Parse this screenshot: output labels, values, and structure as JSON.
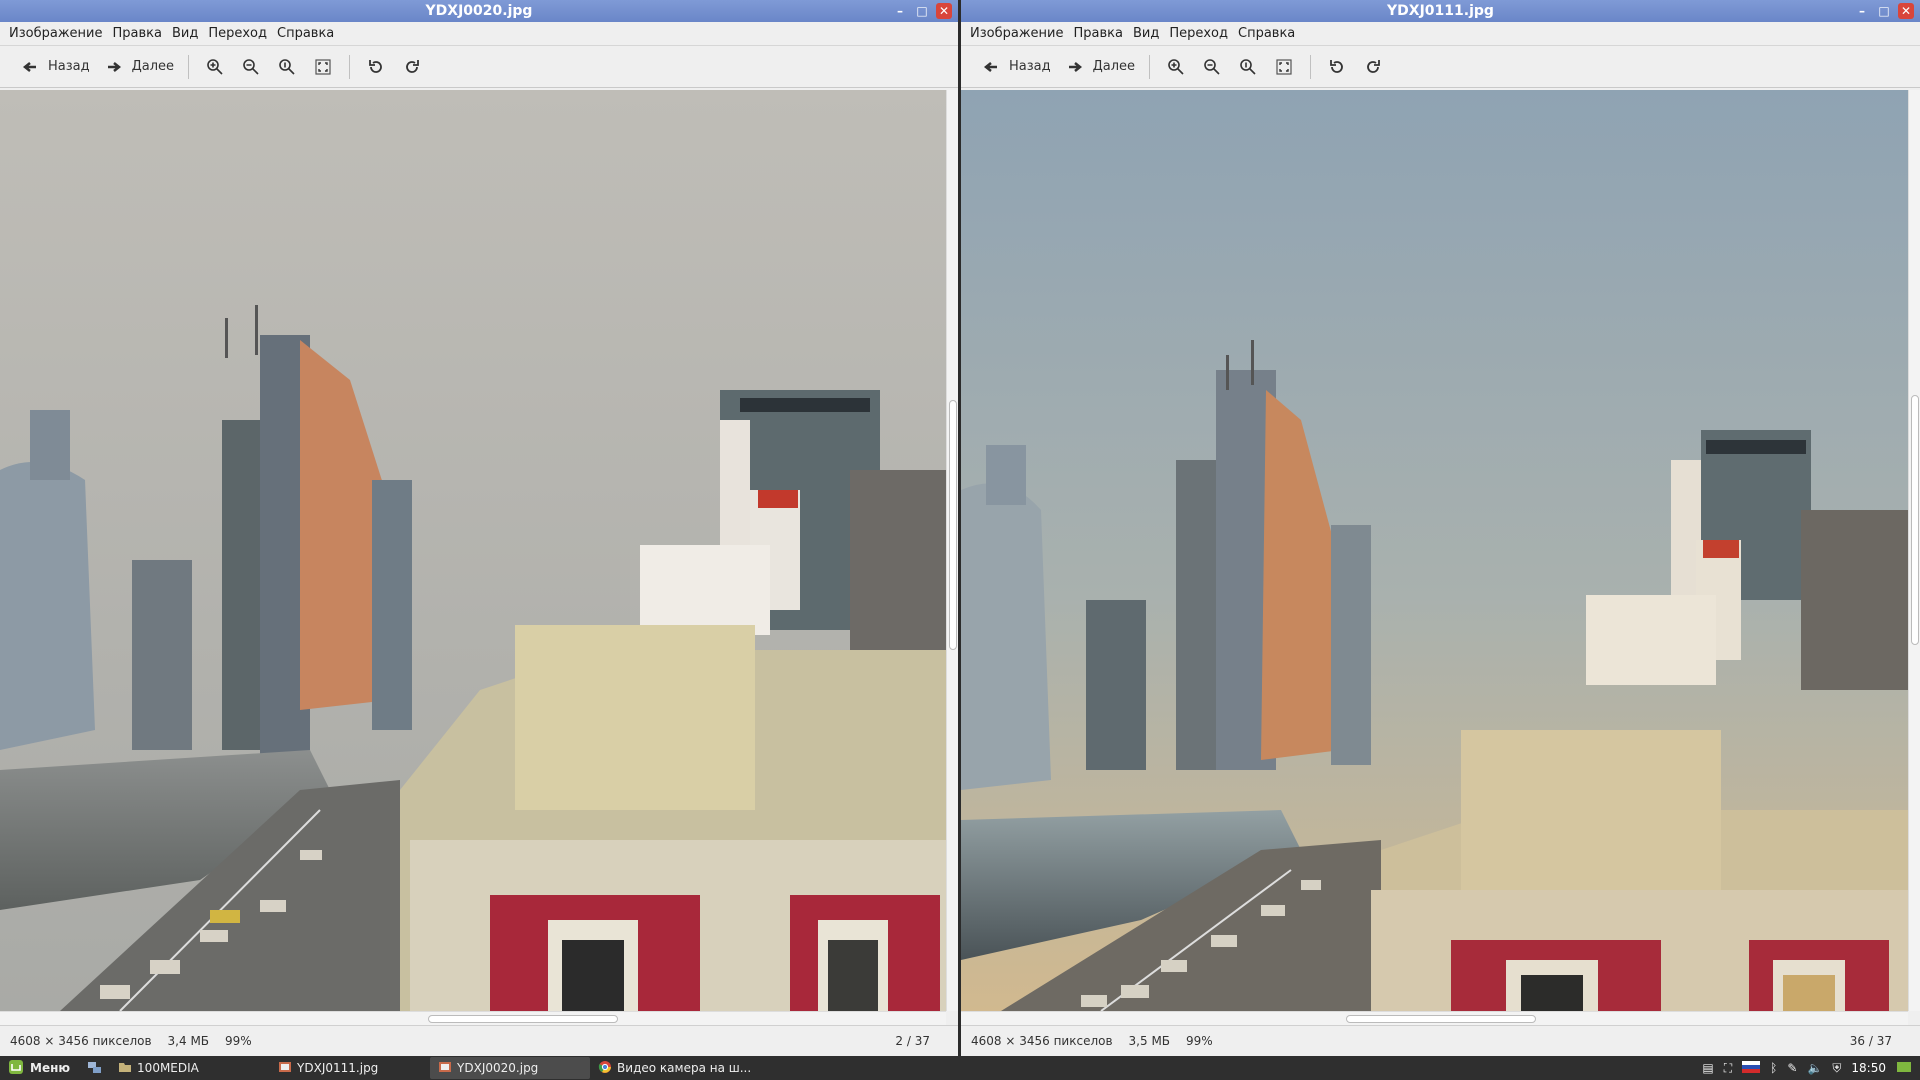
{
  "left_window": {
    "title": "YDXJ0020.jpg",
    "menu": [
      "Изображение",
      "Правка",
      "Вид",
      "Переход",
      "Справка"
    ],
    "toolbar": {
      "back_label": "Назад",
      "forward_label": "Далее"
    },
    "status": {
      "dimensions": "4608 × 3456 пикселов",
      "size": "3,4 МБ",
      "zoom": "99%",
      "counter": "2 / 37"
    }
  },
  "right_window": {
    "title": "YDXJ0111.jpg",
    "menu": [
      "Изображение",
      "Правка",
      "Вид",
      "Переход",
      "Справка"
    ],
    "toolbar": {
      "back_label": "Назад",
      "forward_label": "Далее"
    },
    "status": {
      "dimensions": "4608 × 3456 пикселов",
      "size": "3,5 МБ",
      "zoom": "99%",
      "counter": "36 / 37"
    }
  },
  "taskbar": {
    "menu_label": "Меню",
    "tasks": [
      "100MEDIA",
      "YDXJ0111.jpg",
      "YDXJ0020.jpg",
      "Видео камера на ш..."
    ],
    "clock": "18:50"
  },
  "colors": {
    "titlebar": "#7388cc",
    "close": "#d9453b",
    "sky_left": "#b9b8b3",
    "sky_right": "#8ea4b0"
  }
}
